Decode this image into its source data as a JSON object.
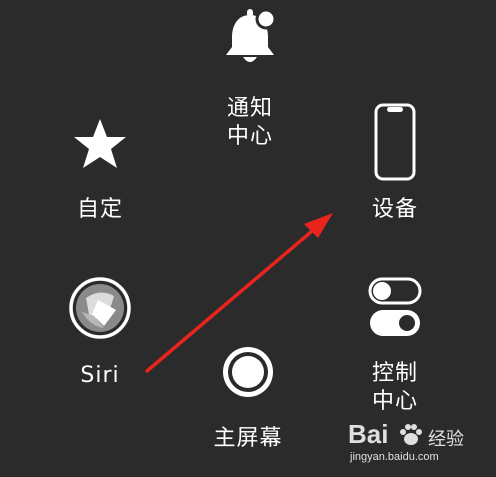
{
  "menu": {
    "notification": {
      "label": "通知\n中心",
      "icon": "bell-icon"
    },
    "custom": {
      "label": "自定",
      "icon": "star-icon"
    },
    "device": {
      "label": "设备",
      "icon": "iphone-icon"
    },
    "siri": {
      "label": "Siri",
      "icon": "siri-icon"
    },
    "control": {
      "label": "控制\n中心",
      "icon": "toggle-switches-icon"
    },
    "home": {
      "label": "主屏幕",
      "icon": "home-button-icon"
    }
  },
  "watermark": {
    "brand_left": "Bai",
    "brand_right": "经验",
    "url": "jingyan.baidu.com"
  },
  "colors": {
    "background": "#2b2b2b",
    "foreground": "#ffffff",
    "arrow": "#e8241c"
  }
}
